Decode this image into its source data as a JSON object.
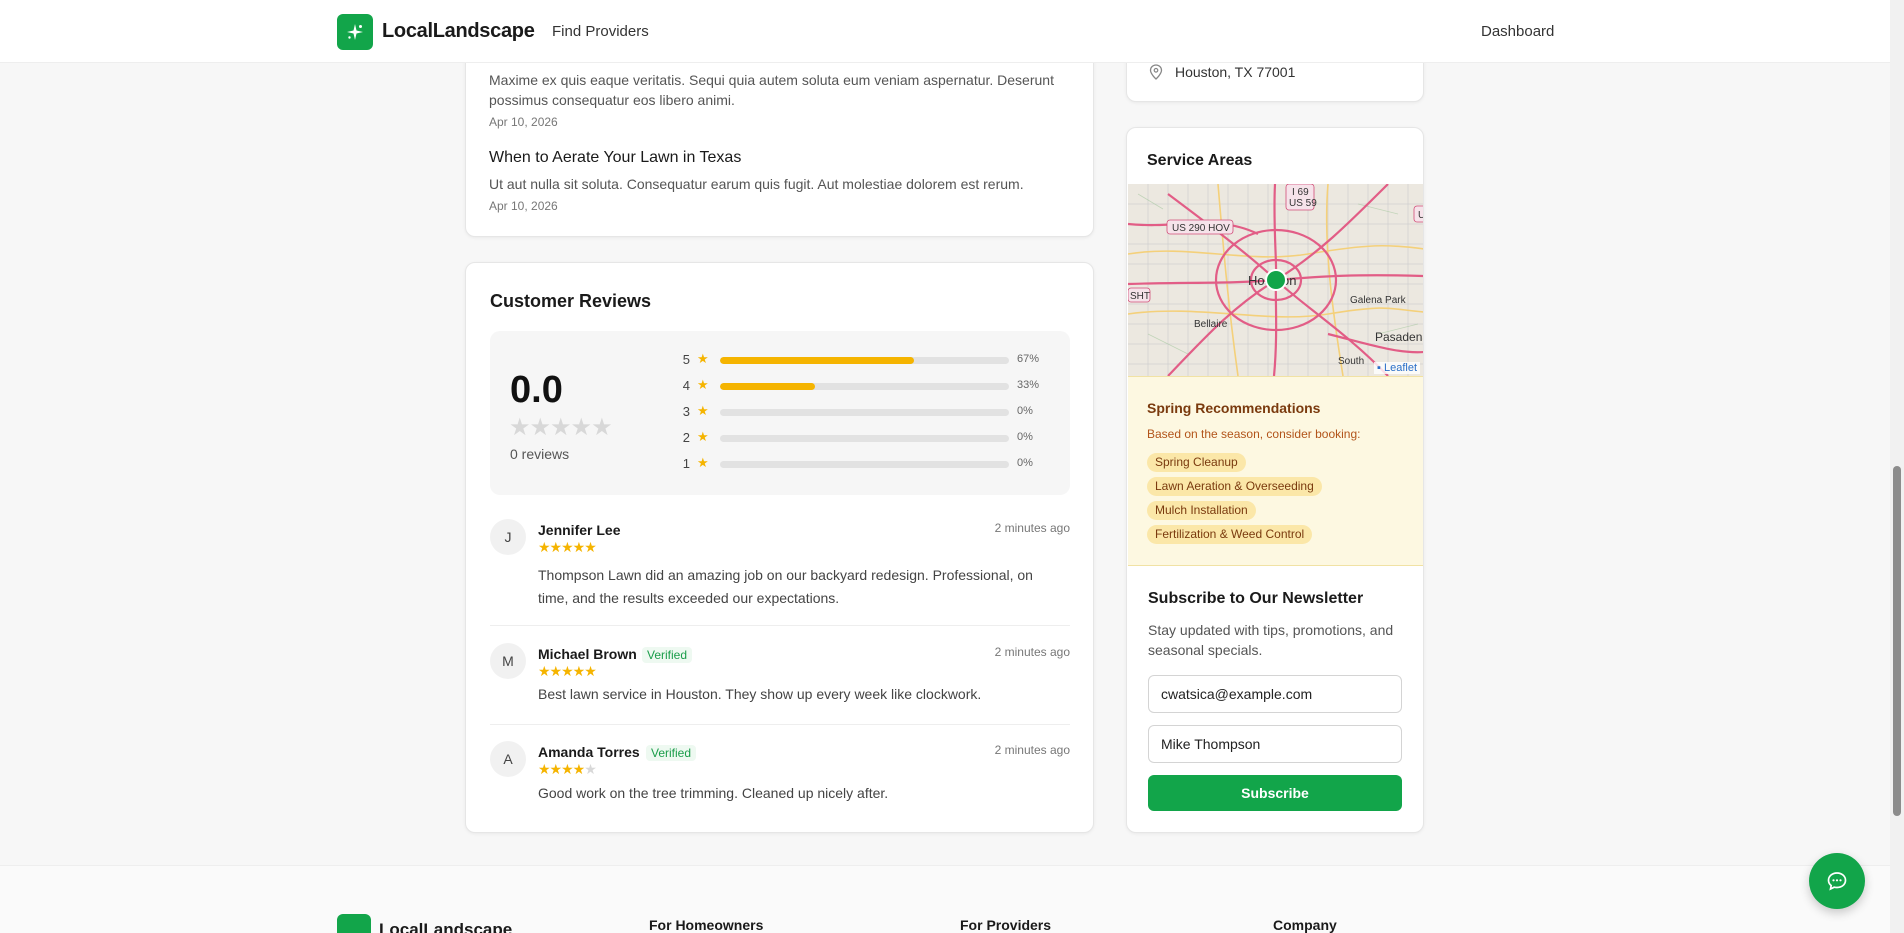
{
  "header": {
    "logo_text": "LocalLandscape",
    "nav_find": "Find Providers",
    "nav_dashboard": "Dashboard"
  },
  "blog": {
    "posts": [
      {
        "title": "",
        "excerpt": "Maxime ex quis eaque veritatis. Sequi quia autem soluta eum veniam aspernatur. Deserunt possimus consequatur eos libero animi.",
        "date": "Apr 10, 2026"
      },
      {
        "title": "When to Aerate Your Lawn in Texas",
        "excerpt": "Ut aut nulla sit soluta. Consequatur earum quis fugit. Aut molestiae dolorem est rerum.",
        "date": "Apr 10, 2026"
      }
    ]
  },
  "reviews": {
    "title": "Customer Reviews",
    "average": "0.0",
    "count_label": "0 reviews",
    "distribution": [
      {
        "stars": "5",
        "pct": 67,
        "pct_label": "67%"
      },
      {
        "stars": "4",
        "pct": 33,
        "pct_label": "33%"
      },
      {
        "stars": "3",
        "pct": 0,
        "pct_label": "0%"
      },
      {
        "stars": "2",
        "pct": 0,
        "pct_label": "0%"
      },
      {
        "stars": "1",
        "pct": 0,
        "pct_label": "0%"
      }
    ],
    "items": [
      {
        "initial": "J",
        "name": "Jennifer Lee",
        "verified": "",
        "rating": 5,
        "time": "2 minutes ago",
        "text": "Thompson Lawn did an amazing job on our backyard redesign. Professional, on time, and the results exceeded our expectations."
      },
      {
        "initial": "M",
        "name": "Michael Brown",
        "verified": "Verified",
        "rating": 5,
        "time": "2 minutes ago",
        "text": "Best lawn service in Houston. They show up every week like clockwork."
      },
      {
        "initial": "A",
        "name": "Amanda Torres",
        "verified": "Verified",
        "rating": 4,
        "time": "2 minutes ago",
        "text": "Good work on the tree trimming. Cleaned up nicely after."
      }
    ]
  },
  "location": {
    "address": "Houston, TX 77001"
  },
  "service_areas": {
    "title": "Service Areas",
    "map_labels": [
      "I 69",
      "US 59",
      "US 290 HOV",
      "Houston",
      "Galena Park",
      "SHT",
      "Bellaire",
      "Pasadena",
      "South"
    ],
    "attribution": "Leaflet"
  },
  "spring": {
    "title": "Spring Recommendations",
    "subtitle": "Based on the season, consider booking:",
    "chips": [
      "Spring Cleanup",
      "Lawn Aeration & Overseeding",
      "Mulch Installation",
      "Fertilization & Weed Control"
    ]
  },
  "newsletter": {
    "title": "Subscribe to Our Newsletter",
    "subtitle": "Stay updated with tips, promotions, and seasonal specials.",
    "email_value": "cwatsica@example.com",
    "name_value": "Mike Thompson",
    "button": "Subscribe"
  },
  "footer": {
    "logo_text": "LocalLandscape",
    "columns": [
      "For Homeowners",
      "For Providers",
      "Company"
    ]
  },
  "colors": {
    "brand": "#12a54a",
    "star": "#f5b400"
  }
}
